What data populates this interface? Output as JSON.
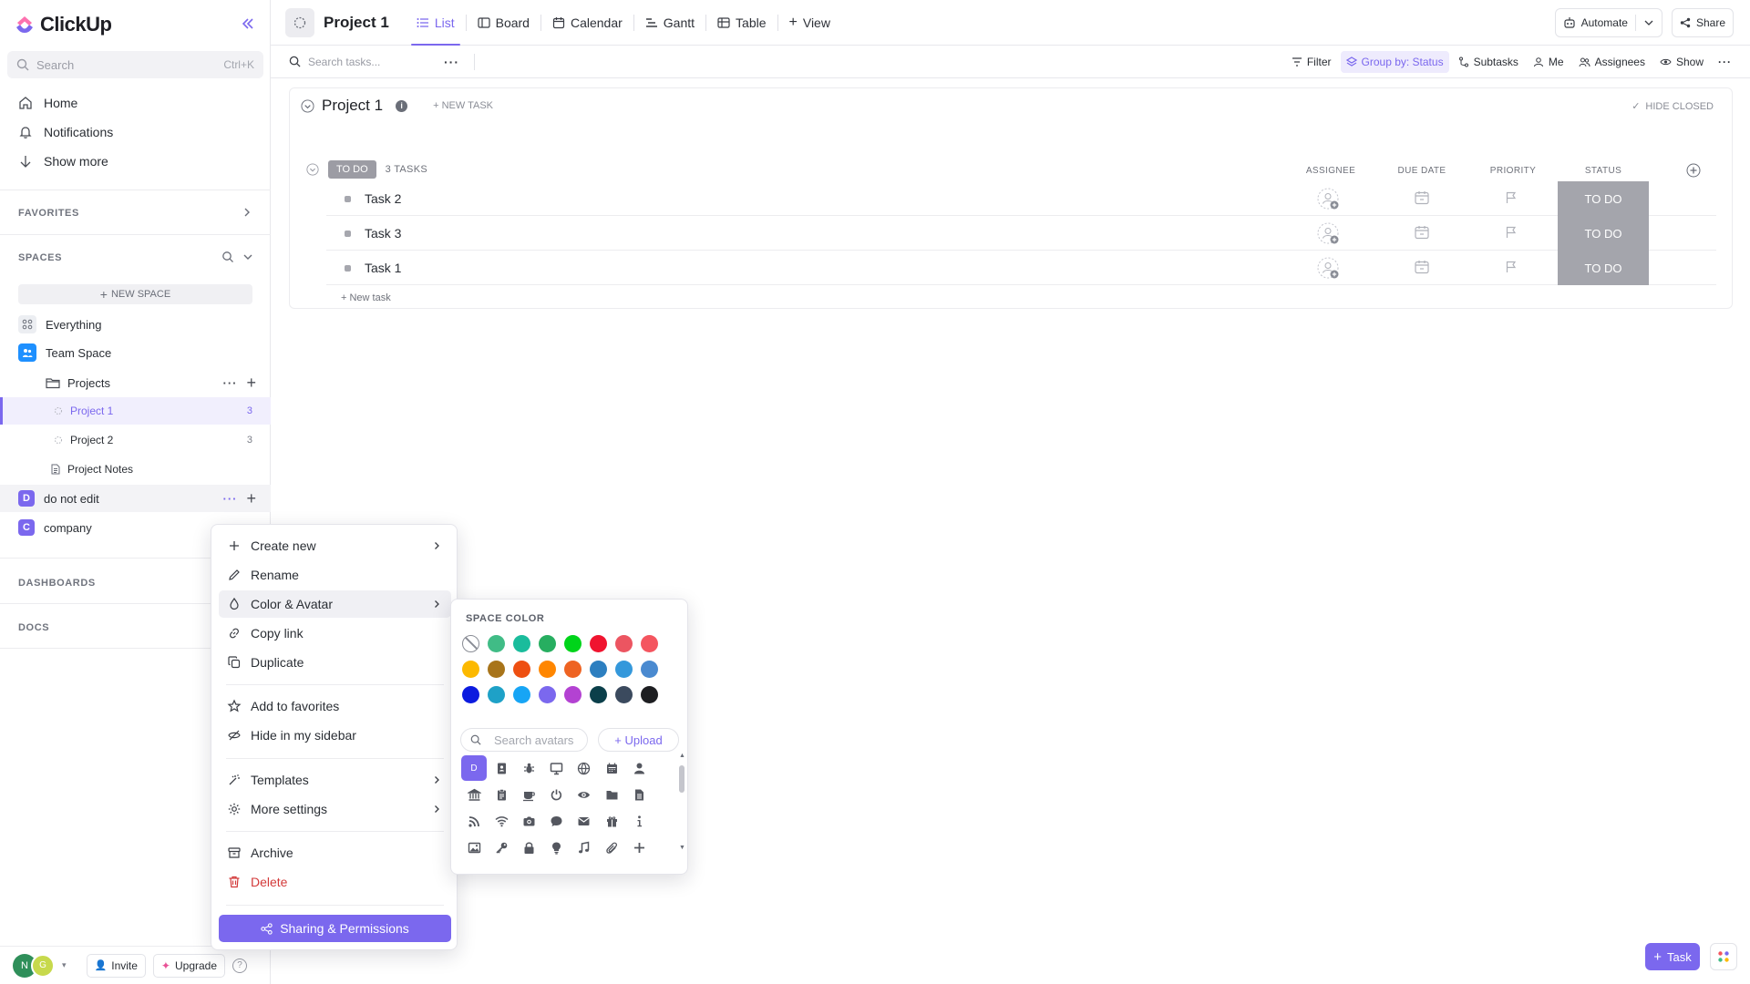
{
  "sidebar": {
    "logo_text": "ClickUp",
    "search": {
      "placeholder": "Search",
      "shortcut": "Ctrl+K"
    },
    "nav": [
      {
        "label": "Home",
        "icon": "home-icon"
      },
      {
        "label": "Notifications",
        "icon": "bell-icon"
      },
      {
        "label": "Show more",
        "icon": "arrow-down-icon"
      }
    ],
    "favorites_label": "FAVORITES",
    "spaces_label": "SPACES",
    "new_space_label": "NEW SPACE",
    "tree": [
      {
        "label": "Everything"
      },
      {
        "label": "Team Space"
      },
      {
        "label": "Projects"
      },
      {
        "label": "Project 1",
        "count": "3"
      },
      {
        "label": "Project 2",
        "count": "3"
      },
      {
        "label": "Project Notes"
      },
      {
        "label": "do not edit",
        "avatar": "D"
      },
      {
        "label": "company",
        "avatar": "C"
      }
    ],
    "dashboards_label": "DASHBOARDS",
    "docs_label": "DOCS",
    "bottom": {
      "avatar_1": "N",
      "avatar_2": "G",
      "invite_label": "Invite",
      "upgrade_label": "Upgrade"
    }
  },
  "topbar": {
    "title": "Project 1",
    "views": [
      {
        "label": "List",
        "active": true
      },
      {
        "label": "Board"
      },
      {
        "label": "Calendar"
      },
      {
        "label": "Gantt"
      },
      {
        "label": "Table"
      }
    ],
    "add_view_label": "View",
    "automate_label": "Automate",
    "share_label": "Share"
  },
  "toolbar": {
    "search_placeholder": "Search tasks...",
    "filter_label": "Filter",
    "group_label": "Group by: Status",
    "subtasks_label": "Subtasks",
    "me_label": "Me",
    "assignees_label": "Assignees",
    "show_label": "Show"
  },
  "list": {
    "title": "Project 1",
    "new_task_label": "+ NEW TASK",
    "hide_closed_label": "HIDE CLOSED",
    "group": {
      "status": "TO DO",
      "count_label": "3 TASKS"
    },
    "columns": [
      "ASSIGNEE",
      "DUE DATE",
      "PRIORITY",
      "STATUS"
    ],
    "tasks": [
      {
        "name": "Task 2",
        "status": "TO DO"
      },
      {
        "name": "Task 3",
        "status": "TO DO"
      },
      {
        "name": "Task 1",
        "status": "TO DO"
      }
    ],
    "add_task_label": "+ New task"
  },
  "context_menu": {
    "items": [
      {
        "label": "Create new",
        "icon": "plus-icon",
        "submenu": true
      },
      {
        "label": "Rename",
        "icon": "pencil-icon"
      },
      {
        "label": "Color & Avatar",
        "icon": "droplet-icon",
        "submenu": true,
        "highlighted": true
      },
      {
        "label": "Copy link",
        "icon": "link-icon"
      },
      {
        "label": "Duplicate",
        "icon": "copy-icon"
      },
      {
        "label": "Add to favorites",
        "icon": "star-icon"
      },
      {
        "label": "Hide in my sidebar",
        "icon": "eye-off-icon"
      },
      {
        "label": "Templates",
        "icon": "wand-icon",
        "submenu": true
      },
      {
        "label": "More settings",
        "icon": "gear-icon",
        "submenu": true
      },
      {
        "label": "Archive",
        "icon": "archive-icon"
      },
      {
        "label": "Delete",
        "icon": "trash-icon",
        "danger": true
      }
    ],
    "share_button_label": "Sharing & Permissions"
  },
  "color_panel": {
    "title": "SPACE COLOR",
    "colors": [
      "none",
      "#40bc86",
      "#1abc9c",
      "#27ae60",
      "#00d41a",
      "#f0142f",
      "#ec5561",
      "#f4555f",
      "#fcb900",
      "#a8741a",
      "#ee4f11",
      "#ff8600",
      "#ee6322",
      "#2d7fc0",
      "#3498db",
      "#4a8ad0",
      "#0c1bdf",
      "#1ea1c7",
      "#17a5f5",
      "#7b68ee",
      "#b342d2",
      "#0b3f4a",
      "#3b4a5e",
      "#1d1e21"
    ],
    "search_placeholder": "Search avatars",
    "upload_label": "+ Upload",
    "selected_avatar_letter": "D",
    "avatar_icons": [
      "letter-avatar",
      "contact-book-icon",
      "bug-icon",
      "monitor-icon",
      "globe-icon",
      "calendar-icon",
      "user-icon",
      "bank-icon",
      "clipboard-icon",
      "coffee-icon",
      "power-icon",
      "eye-icon",
      "folder-icon",
      "file-icon",
      "rss-icon",
      "wifi-icon",
      "camera-icon",
      "chat-icon",
      "mail-icon",
      "gift-icon",
      "info-icon",
      "image-icon",
      "key-icon",
      "lock-icon",
      "lightbulb-icon",
      "music-icon",
      "paperclip-icon",
      "plus-icon"
    ]
  },
  "floating": {
    "task_label": "Task"
  }
}
